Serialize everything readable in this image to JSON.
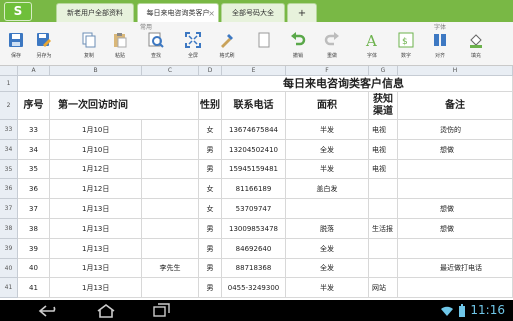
{
  "app": {
    "logo": "S"
  },
  "tabs": [
    {
      "label": "新老用户全部资料",
      "active": false
    },
    {
      "label": "每日来电咨询类客户",
      "active": true,
      "close": "×"
    },
    {
      "label": "全部号码大全",
      "active": false
    },
    {
      "label": "+",
      "active": false
    }
  ],
  "ribbon": {
    "groups": [
      "常用",
      "字体"
    ],
    "tools": [
      {
        "label": "保存",
        "icon": "save-icon"
      },
      {
        "label": "另存为",
        "icon": "save-as-icon"
      },
      {
        "label": "复制",
        "icon": "copy-icon"
      },
      {
        "label": "粘贴",
        "icon": "paste-icon"
      },
      {
        "label": "查找",
        "icon": "find-icon"
      },
      {
        "label": "全屏",
        "icon": "fullscreen-icon"
      },
      {
        "label": "格式刷",
        "icon": "format-painter-icon"
      },
      {
        "label": "",
        "icon": "blank-icon"
      },
      {
        "label": "撤销",
        "icon": "undo-icon"
      },
      {
        "label": "重做",
        "icon": "redo-icon"
      },
      {
        "label": "字体",
        "icon": "font-icon"
      },
      {
        "label": "数字",
        "icon": "number-icon"
      },
      {
        "label": "对齐",
        "icon": "align-icon"
      },
      {
        "label": "填充",
        "icon": "fill-icon"
      }
    ]
  },
  "grid": {
    "columns": [
      "A",
      "B",
      "C",
      "D",
      "E",
      "F",
      "G",
      "H"
    ],
    "title_row": {
      "row": "1",
      "text": "每日来电咨询类客户信息"
    },
    "header_row": {
      "row": "2",
      "cells": [
        "序号",
        "第一次回访时间",
        "",
        "性别",
        "联系电话",
        "面积",
        "获知渠道",
        "备注"
      ]
    },
    "rows": [
      {
        "row": "33",
        "cells": [
          "33",
          "1月10日",
          "",
          "女",
          "13674675844",
          "半发",
          "电视",
          "烫伤的"
        ]
      },
      {
        "row": "34",
        "cells": [
          "34",
          "1月10日",
          "",
          "男",
          "13204502410",
          "全发",
          "电视",
          "想做"
        ]
      },
      {
        "row": "35",
        "cells": [
          "35",
          "1月12日",
          "",
          "男",
          "15945159481",
          "半发",
          "电视",
          ""
        ]
      },
      {
        "row": "36",
        "cells": [
          "36",
          "1月12日",
          "",
          "女",
          "81166189",
          "盖白发",
          "",
          ""
        ]
      },
      {
        "row": "37",
        "cells": [
          "37",
          "1月13日",
          "",
          "女",
          "53709747",
          "",
          "",
          "想做"
        ]
      },
      {
        "row": "38",
        "cells": [
          "38",
          "1月13日",
          "",
          "男",
          "13009853478",
          "脱落",
          "生活报",
          "想做"
        ]
      },
      {
        "row": "39",
        "cells": [
          "39",
          "1月13日",
          "",
          "男",
          "84692640",
          "全发",
          "",
          ""
        ]
      },
      {
        "row": "40",
        "cells": [
          "40",
          "1月13日",
          "李先生",
          "男",
          "88718368",
          "全发",
          "",
          "最近做打电话"
        ]
      },
      {
        "row": "41",
        "cells": [
          "41",
          "1月13日",
          "",
          "男",
          "0455-3249300",
          "半发",
          "网站",
          ""
        ]
      }
    ]
  },
  "status_bar": {
    "time": "11:16",
    "signal": "wifi-icon",
    "battery": "battery-icon",
    "nav": [
      "back-icon",
      "home-icon",
      "recent-apps-icon"
    ]
  }
}
